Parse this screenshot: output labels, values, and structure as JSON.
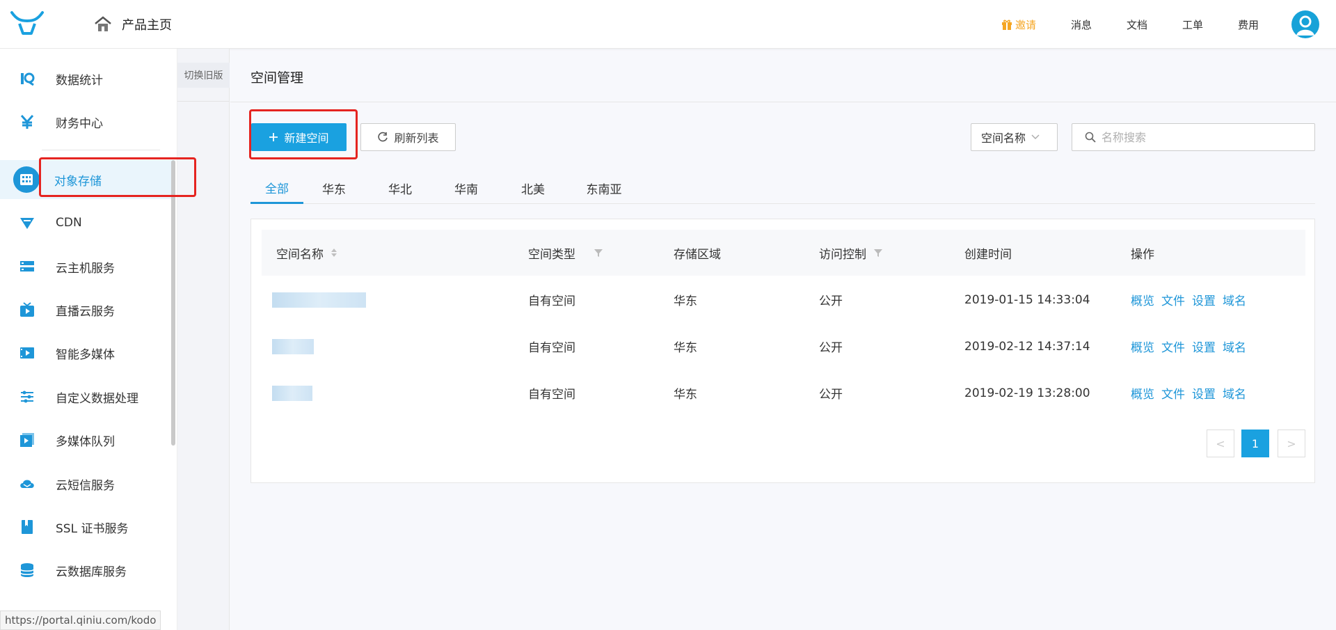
{
  "header": {
    "home_label": "产品主页",
    "invite": "邀请",
    "links": [
      "消息",
      "文档",
      "工单",
      "费用"
    ],
    "brand_color": "#1aa1e0",
    "invite_color": "#f5a623"
  },
  "sidebar": {
    "items": [
      {
        "label": "数据统计",
        "icon": "stats-icon"
      },
      {
        "label": "财务中心",
        "icon": "yen-icon"
      },
      {
        "label": "对象存储",
        "icon": "storage-grid-icon",
        "active": true
      },
      {
        "label": "CDN",
        "icon": "cdn-icon"
      },
      {
        "label": "云主机服务",
        "icon": "server-icon"
      },
      {
        "label": "直播云服务",
        "icon": "live-tv-icon"
      },
      {
        "label": "智能多媒体",
        "icon": "media-icon"
      },
      {
        "label": "自定义数据处理",
        "icon": "sliders-icon"
      },
      {
        "label": "多媒体队列",
        "icon": "queue-icon"
      },
      {
        "label": "云短信服务",
        "icon": "sms-cloud-icon"
      },
      {
        "label": "SSL 证书服务",
        "icon": "certificate-icon"
      },
      {
        "label": "云数据库服务",
        "icon": "database-icon"
      }
    ]
  },
  "subcol": {
    "switch_old": "切换旧版"
  },
  "status_bar": {
    "url": "https://portal.qiniu.com/kodo"
  },
  "main": {
    "title": "空间管理",
    "new_button": "新建空间",
    "refresh_button": "刷新列表",
    "filter_select": "空间名称",
    "search_placeholder": "名称搜索",
    "tabs": [
      "全部",
      "华东",
      "华北",
      "华南",
      "北美",
      "东南亚"
    ],
    "active_tab": "全部",
    "table": {
      "headers": [
        "空间名称",
        "空间类型",
        "存储区域",
        "访问控制",
        "创建时间",
        "操作"
      ],
      "rows": [
        {
          "type": "自有空间",
          "region": "华东",
          "access": "公开",
          "created": "2019-01-15 14:33:04"
        },
        {
          "type": "自有空间",
          "region": "华东",
          "access": "公开",
          "created": "2019-02-12 14:37:14"
        },
        {
          "type": "自有空间",
          "region": "华东",
          "access": "公开",
          "created": "2019-02-19 13:28:00"
        }
      ],
      "actions": [
        "概览",
        "文件",
        "设置",
        "域名"
      ]
    },
    "pagination": {
      "prev": "<",
      "current": "1",
      "next": ">"
    }
  },
  "highlight_color": "#e52420"
}
